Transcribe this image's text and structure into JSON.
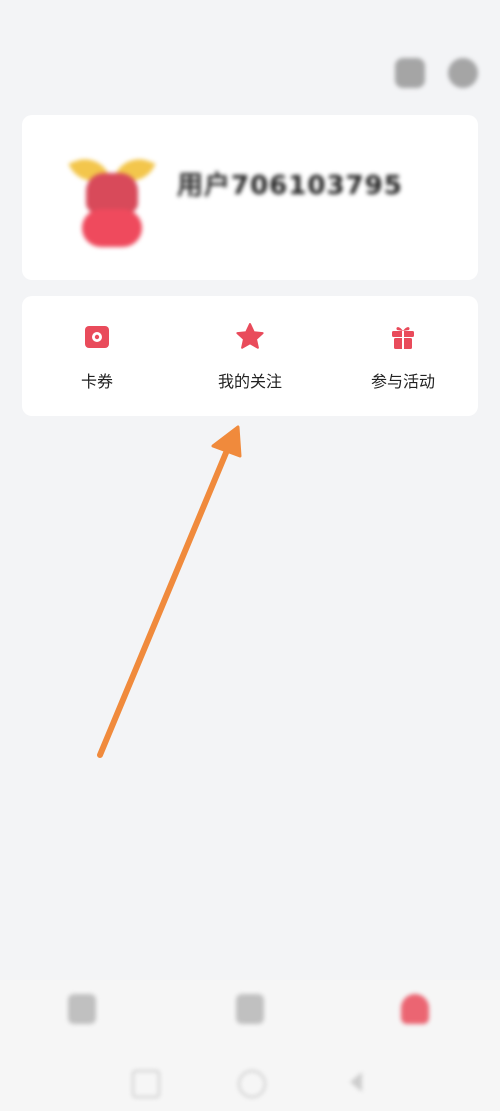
{
  "status_bar": {
    "time": "",
    "right": ""
  },
  "profile": {
    "username": "用户706103795",
    "subline": ""
  },
  "menu": {
    "items": [
      {
        "label": "卡券",
        "icon": "coupon-icon"
      },
      {
        "label": "我的关注",
        "icon": "star-icon"
      },
      {
        "label": "参与活动",
        "icon": "gift-icon"
      }
    ]
  },
  "bottom_nav": {
    "items": [
      {
        "label": "",
        "icon": "home-icon"
      },
      {
        "label": "",
        "icon": "discover-icon"
      },
      {
        "label": "",
        "icon": "me-icon",
        "active": true
      }
    ]
  },
  "colors": {
    "accent": "#e94b5b",
    "arrow": "#f08a3c",
    "background": "#f3f4f6"
  }
}
